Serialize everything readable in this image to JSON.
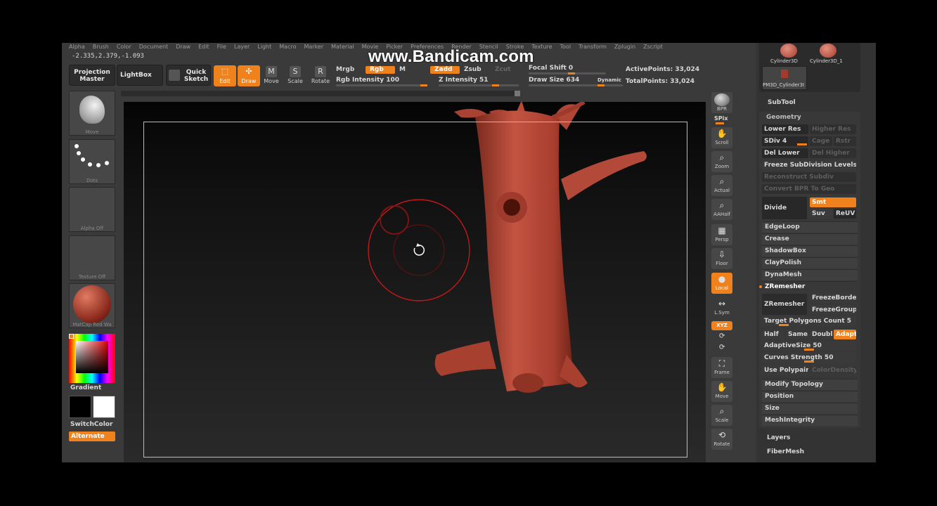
{
  "watermark": "www.Bandicam.com",
  "menu": [
    "Alpha",
    "Brush",
    "Color",
    "Document",
    "Draw",
    "Edit",
    "File",
    "Layer",
    "Light",
    "Macro",
    "Marker",
    "Material",
    "Movie",
    "Picker",
    "Preferences",
    "Render",
    "Stencil",
    "Stroke",
    "Texture",
    "Tool",
    "Transform",
    "Zplugin",
    "Zscript"
  ],
  "coords": "-2.335,2.379,-1.093",
  "toolbar": {
    "projection_master": "Projection Master",
    "lightbox": "LightBox",
    "quick_sketch": "Quick Sketch",
    "edit": "Edit",
    "draw": "Draw",
    "move": "Move",
    "scale": "Scale",
    "rotate": "Rotate",
    "mrgb": "Mrgb",
    "rgb": "Rgb",
    "m": "M",
    "zadd": "Zadd",
    "zsub": "Zsub",
    "zcut": "Zcut",
    "rgb_intensity": "Rgb Intensity 100",
    "z_intensity": "Z Intensity 51",
    "focal_shift": "Focal Shift 0",
    "draw_size": "Draw Size 634",
    "dynamic": "Dynamic",
    "active_points": "ActivePoints: 33,024",
    "total_points": "TotalPoints: 33,024"
  },
  "left_shelf": {
    "brush": "Move",
    "stroke": "Dots",
    "alpha": "Alpha Off",
    "texture": "Texture Off",
    "material": "MatCap Red Wa",
    "gradient": "Gradient",
    "switch_color": "SwitchColor",
    "alternate": "Alternate"
  },
  "right_shelf": [
    "BPR",
    "SPix",
    "Scroll",
    "Zoom",
    "Actual",
    "AAHalf",
    "Persp",
    "Floor",
    "Local",
    "L.Sym",
    "XYZ",
    "Frame",
    "Move",
    "Scale",
    "Rotate"
  ],
  "subtool_thumbs": [
    "Cylinder3D",
    "Cylinder3D_1",
    "PM3D_Cylinder3I"
  ],
  "panel": {
    "subtool": "SubTool",
    "geometry": "Geometry",
    "lower_res": "Lower Res",
    "higher_res": "Higher Res",
    "sdiv": "SDiv 4",
    "cage": "Cage",
    "rstr": "Rstr",
    "del_lower": "Del Lower",
    "del_higher": "Del Higher",
    "freeze_subdiv": "Freeze SubDivision Levels",
    "reconstruct_subdiv": "Reconstruct Subdiv",
    "convert_bpr": "Convert BPR To Geo",
    "divide": "Divide",
    "smt": "Smt",
    "suv": "Suv",
    "reuv": "ReUV",
    "edgeloop": "EdgeLoop",
    "crease": "Crease",
    "shadowbox": "ShadowBox",
    "claypolish": "ClayPolish",
    "dynamesh": "DynaMesh",
    "zremesher_section": "ZRemesher",
    "zremesher_btn": "ZRemesher",
    "freeze_border": "FreezeBorder",
    "freeze_groups": "FreezeGroups",
    "target_polygons": "Target Polygons Count 5",
    "half": "Half",
    "same": "Same",
    "double": "Double",
    "adapt": "Adapt",
    "adaptive_size": "AdaptiveSize 50",
    "curves_strength": "Curves Strength 50",
    "use_polypaint": "Use Polypaint",
    "color_density": "ColorDensity",
    "modify_topology": "Modify Topology",
    "position": "Position",
    "size": "Size",
    "mesh_integrity": "MeshIntegrity",
    "layers": "Layers",
    "fibermesh": "FiberMesh"
  },
  "colors": {
    "accent": "#f0821e",
    "mesh": "#b5483a",
    "panel": "#333333",
    "brush_ring": "#c21818"
  },
  "icons": [
    "rotate-cursor-icon",
    "gear-icon"
  ]
}
